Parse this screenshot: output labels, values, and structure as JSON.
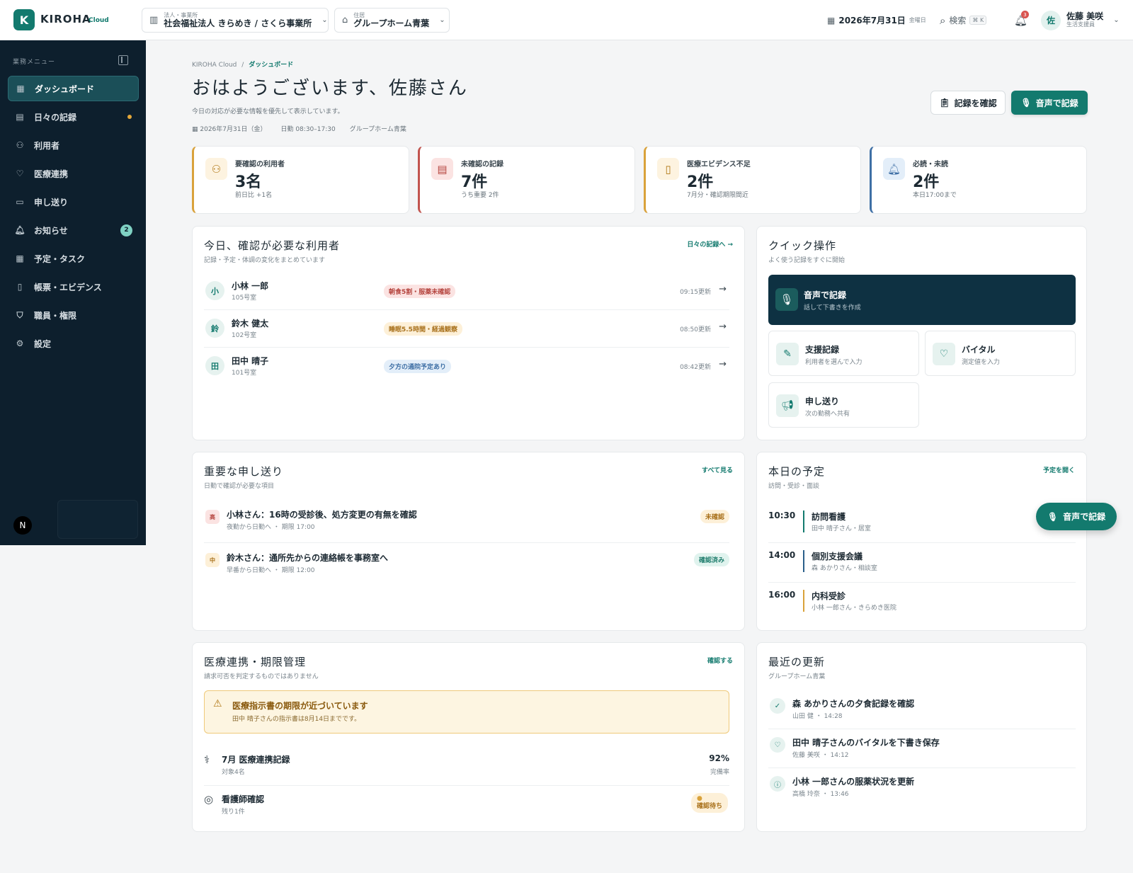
{
  "app": {
    "logo_letter": "K",
    "name": "KIROHA",
    "suffix": "Cloud"
  },
  "topbar": {
    "org": {
      "label": "法人・事業所",
      "value": "社会福祉法人 きらめき / さくら事業所"
    },
    "home": {
      "label": "住居",
      "value": "グループホーム青葉"
    },
    "date": {
      "main": "2026年7月31日",
      "weekday": "金曜日"
    },
    "search": {
      "label": "検索",
      "shortcut": "⌘ K"
    },
    "notifications": {
      "count": "3"
    },
    "user": {
      "initial": "佐",
      "name": "佐藤 美咲",
      "role": "生活支援員"
    }
  },
  "sidebar": {
    "heading": "業務メニュー",
    "items": [
      {
        "label": "ダッシュボード",
        "icon": "grid-icon",
        "active": true
      },
      {
        "label": "日々の記録",
        "icon": "clipboard-icon",
        "dot": true
      },
      {
        "label": "利用者",
        "icon": "users-icon"
      },
      {
        "label": "医療連携",
        "icon": "heart-pulse-icon"
      },
      {
        "label": "申し送り",
        "icon": "message-icon"
      },
      {
        "label": "お知らせ",
        "icon": "bell-icon",
        "badge": "2"
      },
      {
        "label": "予定・タスク",
        "icon": "calendar-icon"
      },
      {
        "label": "帳票・エビデンス",
        "icon": "file-icon"
      },
      {
        "label": "職員・権限",
        "icon": "shield-icon"
      },
      {
        "label": "設定",
        "icon": "gear-icon"
      }
    ],
    "bottom_avatar": "N"
  },
  "header": {
    "breadcrumb_root": "KIROHA Cloud",
    "breadcrumb_sep": "/",
    "breadcrumb_current": "ダッシュボード",
    "title": "おはようございます、佐藤さん",
    "subtitle": "今日の対応が必要な情報を優先して表示しています。",
    "meta_date": "2026年7月31日（金）",
    "meta_shift": "日勤 08:30–17:30",
    "meta_home": "グループホーム青葉",
    "btn_check": "記録を確認",
    "btn_voice": "音声で記録"
  },
  "kpis": [
    {
      "label": "要確認の利用者",
      "value": "3名",
      "sub": "前日比 +1名",
      "color": "#d9a23b"
    },
    {
      "label": "未確認の記録",
      "value": "7件",
      "sub": "うち重要 2件",
      "color": "#c2544e"
    },
    {
      "label": "医療エビデンス不足",
      "value": "2件",
      "sub": "7月分・確認期限間近",
      "color": "#d9a23b"
    },
    {
      "label": "必読・未読",
      "value": "2件",
      "sub": "本日17:00まで",
      "color": "#3e6fa5"
    }
  ],
  "users_card": {
    "title": "今日、確認が必要な利用者",
    "sub": "記録・予定・体調の変化をまとめています",
    "link": "日々の記録へ →",
    "rows": [
      {
        "initial": "小",
        "name": "小林 一郎",
        "room": "105号室",
        "tag": "朝食5割・服薬未確認",
        "tone": "red",
        "time": "09:15更新"
      },
      {
        "initial": "鈴",
        "name": "鈴木 健太",
        "room": "102号室",
        "tag": "睡眠5.5時間・経過観察",
        "tone": "amber",
        "time": "08:50更新"
      },
      {
        "initial": "田",
        "name": "田中 晴子",
        "room": "101号室",
        "tag": "夕方の通院予定あり",
        "tone": "blue",
        "time": "08:42更新"
      }
    ]
  },
  "quick": {
    "title": "クイック操作",
    "sub": "よく使う記録をすぐに開始",
    "main": {
      "title": "音声で記録",
      "sub": "話して下書きを作成"
    },
    "items": [
      {
        "title": "支援記録",
        "sub": "利用者を選んで入力"
      },
      {
        "title": "バイタル",
        "sub": "測定値を入力"
      },
      {
        "title": "申し送り",
        "sub": "次の勤務へ共有"
      }
    ]
  },
  "handover": {
    "title": "重要な申し送り",
    "sub": "日勤で確認が必要な項目",
    "link": "すべて見る",
    "rows": [
      {
        "badge": "高",
        "title": "小林さん：16時の受診後、処方変更の有無を確認",
        "sub": "夜勤から日勤へ ・ 期限 17:00",
        "status": "未確認",
        "tone": "amber"
      },
      {
        "badge": "中",
        "title": "鈴木さん：通所先からの連絡帳を事務室へ",
        "sub": "早番から日勤へ ・ 期限 12:00",
        "status": "確認済み",
        "tone": "green"
      }
    ]
  },
  "schedule": {
    "title": "本日の予定",
    "sub": "訪問・受診・面談",
    "link": "予定を開く",
    "rows": [
      {
        "time": "10:30",
        "title": "訪問看護",
        "sub": "田中 晴子さん・居室",
        "color": "#137a6e"
      },
      {
        "time": "14:00",
        "title": "個別支援会議",
        "sub": "森 あかりさん・相談室",
        "color": "#2b5f8a"
      },
      {
        "time": "16:00",
        "title": "内科受診",
        "sub": "小林 一郎さん・きらめき医院",
        "color": "#d9a23b"
      }
    ]
  },
  "fab": {
    "label": "音声で記録"
  },
  "medical": {
    "title": "医療連携・期限管理",
    "sub": "請求可否を判定するものではありません",
    "link": "確認する",
    "alert_title": "医療指示書の期限が近づいています",
    "alert_sub": "田中 晴子さんの指示書は8月14日までです。",
    "rows": [
      {
        "title": "7月 医療連携記録",
        "sub": "対象4名",
        "value": "92%",
        "value_sub": "完備率"
      },
      {
        "title": "看護師確認",
        "sub": "残り1件",
        "status": "確認待ち"
      }
    ]
  },
  "recent": {
    "title": "最近の更新",
    "sub": "グループホーム青葉",
    "rows": [
      {
        "title": "森 あかりさんの夕食記録を確認",
        "sub": "山田 健 ・ 14:28"
      },
      {
        "title": "田中 晴子さんのバイタルを下書き保存",
        "sub": "佐藤 美咲 ・ 14:12"
      },
      {
        "title": "小林 一郎さんの服薬状況を更新",
        "sub": "高橋 玲奈 ・ 13:46"
      }
    ]
  }
}
